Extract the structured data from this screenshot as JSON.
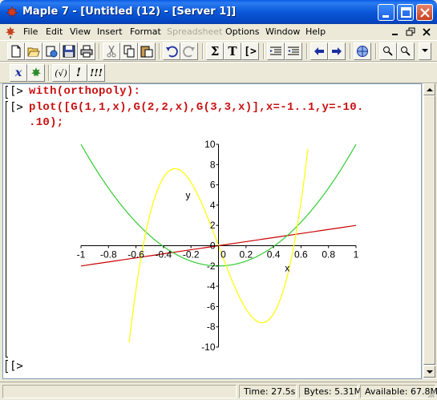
{
  "window": {
    "title": "Maple 7  - [Untitled (12) - [Server 1]]"
  },
  "menu": {
    "items": [
      "File",
      "Edit",
      "View",
      "Insert",
      "Format",
      "Spreadsheet",
      "Options",
      "Window",
      "Help"
    ],
    "disabled": "Spreadsheet"
  },
  "toolbar": {
    "sigma_label": "Σ",
    "text_label": "T",
    "prompt_label": "[>",
    "math_label": "x",
    "check_label": "(√)",
    "exclaim_label": "!",
    "triple_exclaim_label": "!!!"
  },
  "worksheet": {
    "prompt1": "[>",
    "input1": "with(orthopoly):",
    "prompt2": "[>",
    "input2_line1": "plot([G(1,1,x),G(2,2,x),G(3,3,x)],x=-1..1,y=-10.",
    "input2_line2": ".10);",
    "prompt3": "[>"
  },
  "chart_data": {
    "type": "line",
    "xlabel": "x",
    "ylabel": "y",
    "xlim": [
      -1,
      1
    ],
    "ylim": [
      -10,
      10
    ],
    "x_ticks": [
      "-1",
      "-0.8",
      "-0.6",
      "-0.4",
      "-0.2",
      "0",
      "0.2",
      "0.4",
      "0.6",
      "0.8",
      "1"
    ],
    "y_ticks": [
      "10",
      "8",
      "6",
      "4",
      "2",
      "0",
      "-2",
      "-4",
      "-6",
      "-8",
      "-10"
    ],
    "series": [
      {
        "expr": "G(1,1,x) = 2x",
        "color": "#cc0000",
        "x": [
          -1,
          0,
          1
        ],
        "y": [
          -2,
          0,
          2
        ]
      },
      {
        "expr": "G(2,2,x) = 12x^2 - 2",
        "color": "#33cc33",
        "x": [
          -1,
          -0.5,
          0,
          0.5,
          1
        ],
        "y": [
          10,
          1,
          -2,
          1,
          10
        ]
      },
      {
        "expr": "G(3,3,x) = 120x^3 - 36x",
        "color": "#ffff00",
        "x": [
          -0.7,
          -0.55,
          -0.316,
          0,
          0.316,
          0.55,
          0.7
        ],
        "y": [
          -9.96,
          -0.165,
          7.59,
          0,
          -7.59,
          0.165,
          9.96
        ]
      }
    ]
  },
  "status": {
    "time": "Time:  27.5s",
    "bytes": "Bytes: 5.31M",
    "available": "Available: 67.8M"
  }
}
